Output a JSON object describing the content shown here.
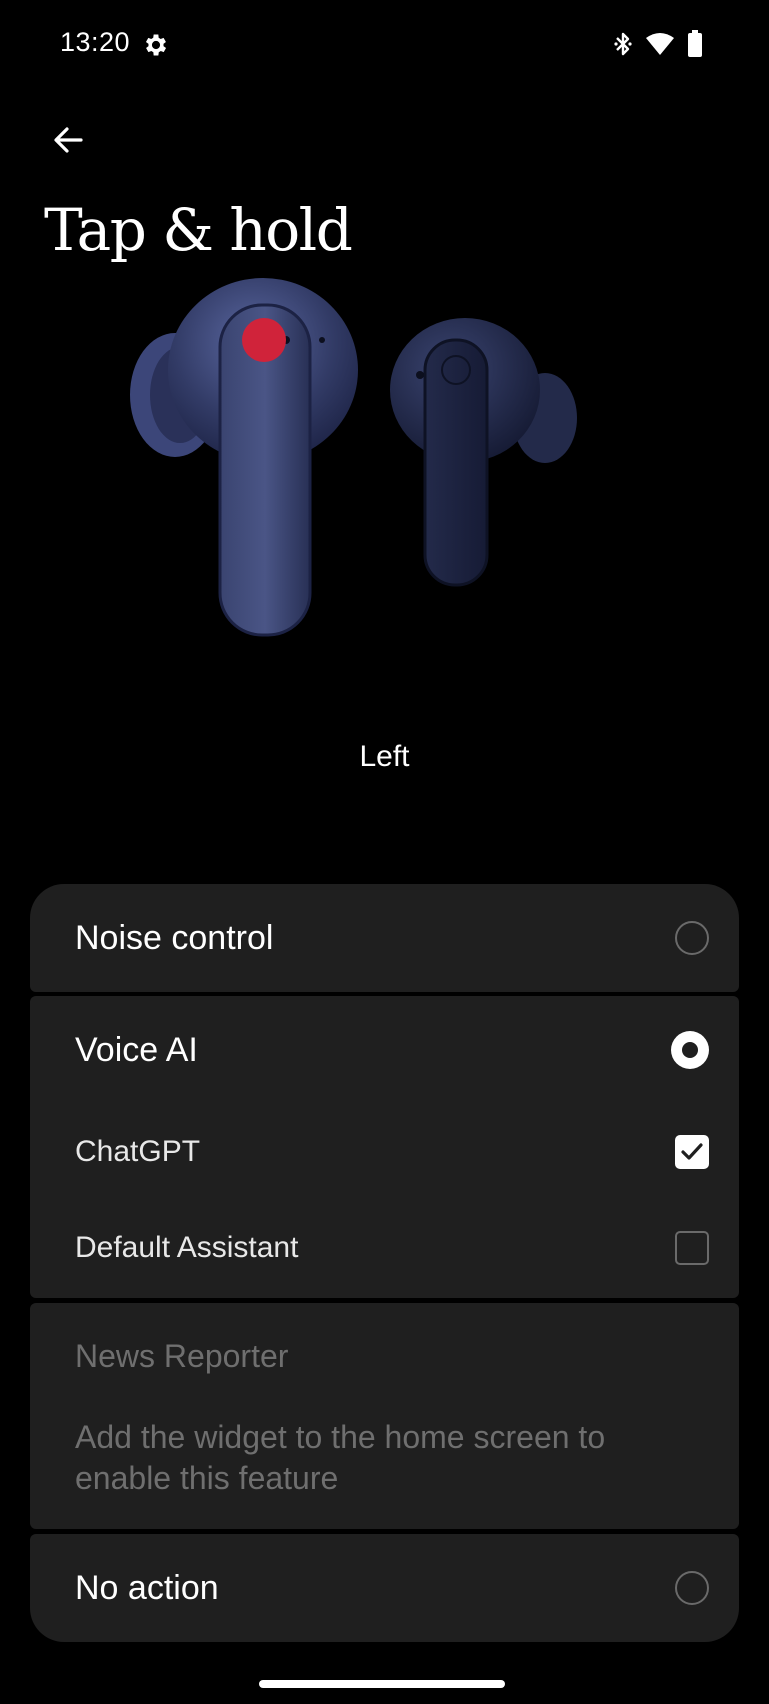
{
  "status_bar": {
    "time": "13:20",
    "icons": [
      "gear-icon",
      "bluetooth-icon",
      "wifi-icon",
      "battery-icon"
    ]
  },
  "header": {
    "back_icon": "arrow-left-icon",
    "title": "Tap & hold"
  },
  "earbud": {
    "selected_side": "Left",
    "accent_color": "#d0233a",
    "body_color": "#2e3658"
  },
  "options": {
    "noise_control": {
      "label": "Noise control",
      "selected": false
    },
    "voice_ai": {
      "label": "Voice AI",
      "selected": true,
      "sub_options": [
        {
          "label": "ChatGPT",
          "checked": true
        },
        {
          "label": "Default Assistant",
          "checked": false
        }
      ]
    },
    "news_reporter": {
      "label": "News Reporter",
      "description": "Add the widget to the home screen to enable this feature",
      "enabled": false
    },
    "no_action": {
      "label": "No action",
      "selected": false
    }
  },
  "colors": {
    "background": "#000000",
    "card": "#1f1f1f",
    "text": "#ffffff",
    "disabled_text": "#6f6f6f"
  }
}
